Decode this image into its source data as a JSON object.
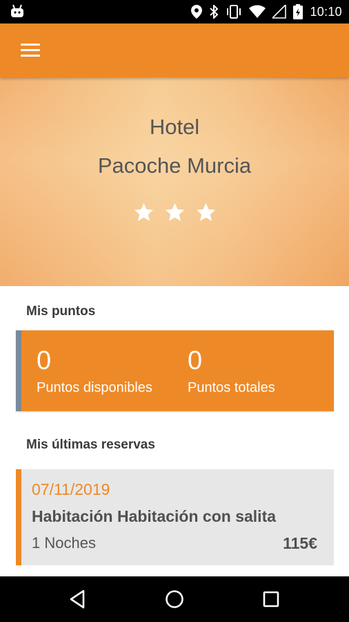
{
  "status_bar": {
    "time": "10:10",
    "icons": [
      "android-icon",
      "location-icon",
      "bluetooth-icon",
      "vibrate-icon",
      "wifi-icon",
      "signal-icon",
      "battery-icon"
    ]
  },
  "app_bar": {
    "menu_icon": "hamburger-menu-icon"
  },
  "hero": {
    "line1": "Hotel",
    "line2": "Pacoche Murcia",
    "stars": 3,
    "star_color": "#ffffff"
  },
  "points": {
    "section_title": "Mis puntos",
    "available_value": "0",
    "available_label": "Puntos disponibles",
    "total_value": "0",
    "total_label": "Puntos totales"
  },
  "bookings": {
    "section_title": "Mis últimas reservas",
    "items": [
      {
        "date": "07/11/2019",
        "room": "Habitación Habitación con salita",
        "nights": "1 Noches",
        "price": "115€"
      }
    ]
  },
  "nav": {
    "buttons": [
      "back-icon",
      "home-icon",
      "recent-apps-icon"
    ]
  },
  "colors": {
    "accent": "#ee8927",
    "card_border": "#7a8a99",
    "booking_bg": "#e7e7e7"
  }
}
